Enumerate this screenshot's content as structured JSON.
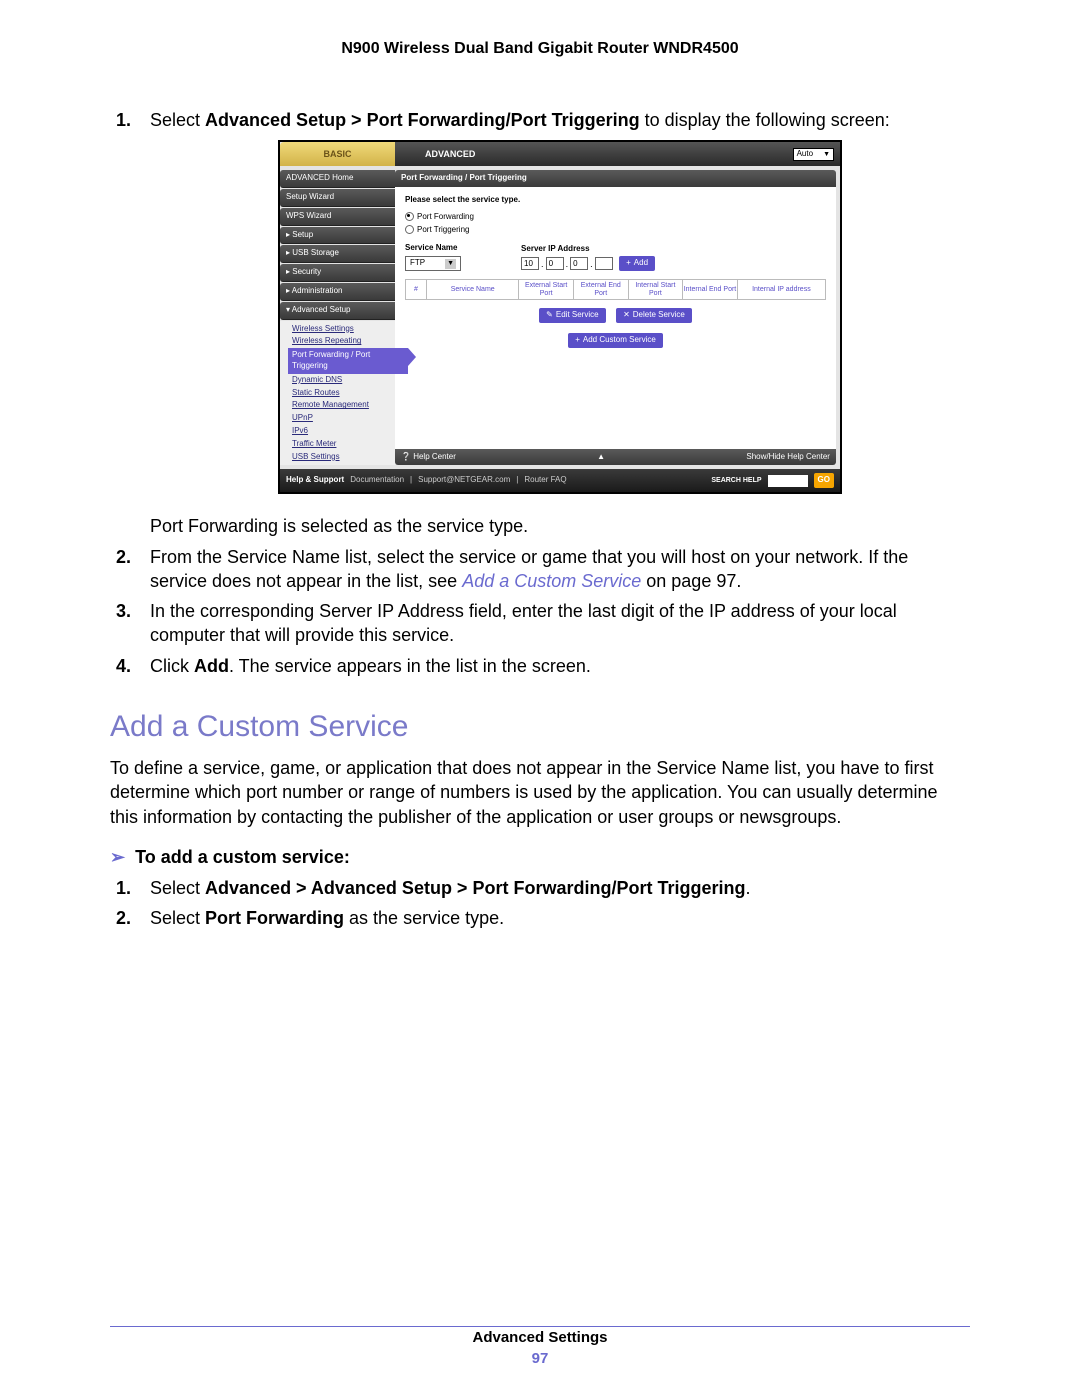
{
  "header": {
    "title": "N900 Wireless Dual Band Gigabit Router WNDR4500"
  },
  "steps": {
    "s1_a": "Select ",
    "s1_b": "Advanced Setup > Port Forwarding/Port Triggering",
    "s1_c": " to display the following screen:",
    "s1_note": "Port Forwarding is selected as the service type.",
    "s2_a": "From the Service Name list, select the service or game that you will host on your network. If the service does not appear in the list, see ",
    "s2_link": "Add a Custom Service",
    "s2_b": " on page 97.",
    "s3": "In the corresponding Server IP Address field, enter the last digit of the IP address of your local computer that will provide this service.",
    "s4_a": "Click ",
    "s4_b": "Add",
    "s4_c": ". The service appears in the list in the screen."
  },
  "section_heading": "Add a Custom Service",
  "section_para": "To define a service, game, or application that does not appear in the Service Name list, you have to first determine which port number or range of numbers is used by the application. You can usually determine this information by contacting the publisher of the application or user groups or newsgroups.",
  "task_head": "To add a custom service:",
  "task_steps": {
    "t1_a": "Select ",
    "t1_b": "Advanced > Advanced Setup > Port Forwarding/Port Triggering",
    "t1_c": ".",
    "t2_a": "Select ",
    "t2_b": "Port Forwarding",
    "t2_c": " as the service type."
  },
  "footer": {
    "section": "Advanced Settings",
    "page": "97"
  },
  "shot": {
    "tab_basic": "BASIC",
    "tab_adv": "ADVANCED",
    "auto": "Auto",
    "side": {
      "home": "ADVANCED Home",
      "setup_wiz": "Setup Wizard",
      "wps": "WPS Wizard",
      "setup": "▸ Setup",
      "usb": "▸ USB Storage",
      "sec": "▸ Security",
      "admin": "▸ Administration",
      "advsetup": "▾ Advanced Setup",
      "subs": {
        "wset": "Wireless Settings",
        "wrep": "Wireless Repeating",
        "active": "Port Forwarding / Port Triggering",
        "ddns": "Dynamic DNS",
        "sroutes": "Static Routes",
        "rmgmt": "Remote Management",
        "upnp": "UPnP",
        "ipv6": "IPv6",
        "tmet": "Traffic Meter",
        "usbs": "USB Settings"
      }
    },
    "content": {
      "head": "Port Forwarding / Port Triggering",
      "prompt": "Please select the service type.",
      "r1": "Port Forwarding",
      "r2": "Port Triggering",
      "svc_label": "Service Name",
      "svc_val": "FTP",
      "ip_label": "Server IP Address",
      "ip": [
        "10",
        "0",
        "0",
        ""
      ],
      "add": "Add",
      "table": [
        "#",
        "Service Name",
        "External Start Port",
        "External End Port",
        "Internal Start Port",
        "Internal End Port",
        "Internal IP address"
      ],
      "btn_edit": "Edit Service",
      "btn_del": "Delete Service",
      "btn_custom": "Add Custom Service",
      "help_center": "Help Center",
      "show_hide": "Show/Hide Help Center"
    },
    "bottom": {
      "hs": "Help & Support",
      "docs": "Documentation",
      "support": "Support@NETGEAR.com",
      "faq": "Router FAQ",
      "search": "SEARCH HELP",
      "go": "GO"
    }
  }
}
